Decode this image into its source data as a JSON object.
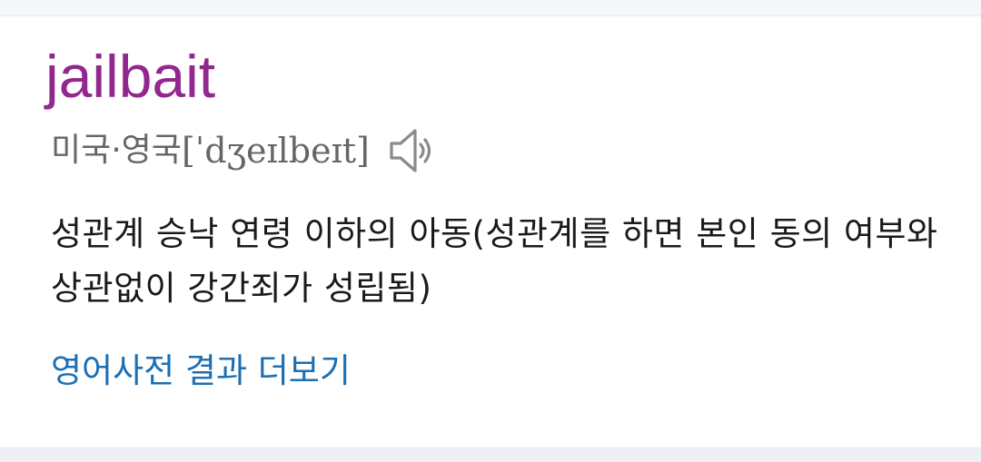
{
  "entry": {
    "word": "jailbait",
    "region": "미국·영국",
    "pronunciation": "[ˈdʒeɪlbeɪt]",
    "speaker_icon": "speaker-icon",
    "definition": "성관계 승낙 연령 이하의 아동(성관계를 하면 본인 동의 여부와 상관없이 강간죄가 성립됨)",
    "more_link": "영어사전 결과 더보기"
  },
  "colors": {
    "word": "#92278f",
    "pronunciation": "#666666",
    "definition": "#1a1a1a",
    "link": "#1a6fb5",
    "icon": "#8a8a8a"
  }
}
